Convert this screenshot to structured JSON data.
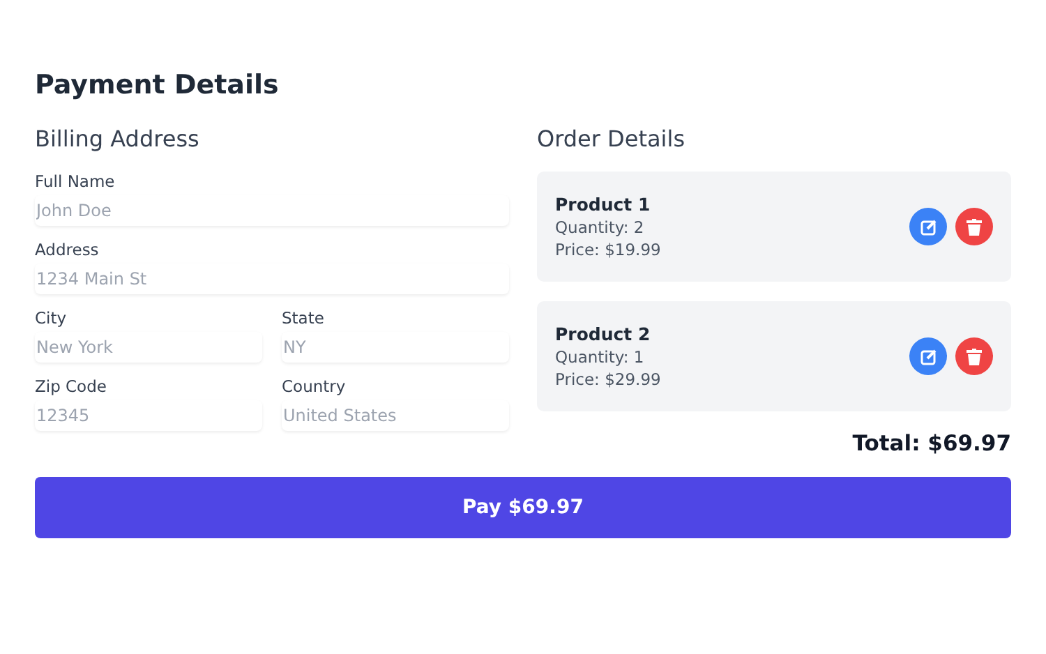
{
  "title": "Payment Details",
  "billing": {
    "heading": "Billing Address",
    "fields": [
      {
        "label": "Full Name",
        "placeholder": "John Doe",
        "kind": "full"
      },
      {
        "label": "Address",
        "placeholder": "1234 Main St",
        "kind": "full"
      },
      {
        "label": "City",
        "placeholder": "New York",
        "kind": "half"
      },
      {
        "label": "State",
        "placeholder": "NY",
        "kind": "half"
      },
      {
        "label": "Zip Code",
        "placeholder": "12345",
        "kind": "half"
      },
      {
        "label": "Country",
        "placeholder": "United States",
        "kind": "half"
      }
    ]
  },
  "order": {
    "heading": "Order Details",
    "items": [
      {
        "name": "Product 1",
        "quantity": "Quantity: 2",
        "price": "Price: $19.99"
      },
      {
        "name": "Product 2",
        "quantity": "Quantity: 1",
        "price": "Price: $29.99"
      }
    ],
    "total": "Total: $69.97"
  },
  "pay_button": "Pay $69.97"
}
